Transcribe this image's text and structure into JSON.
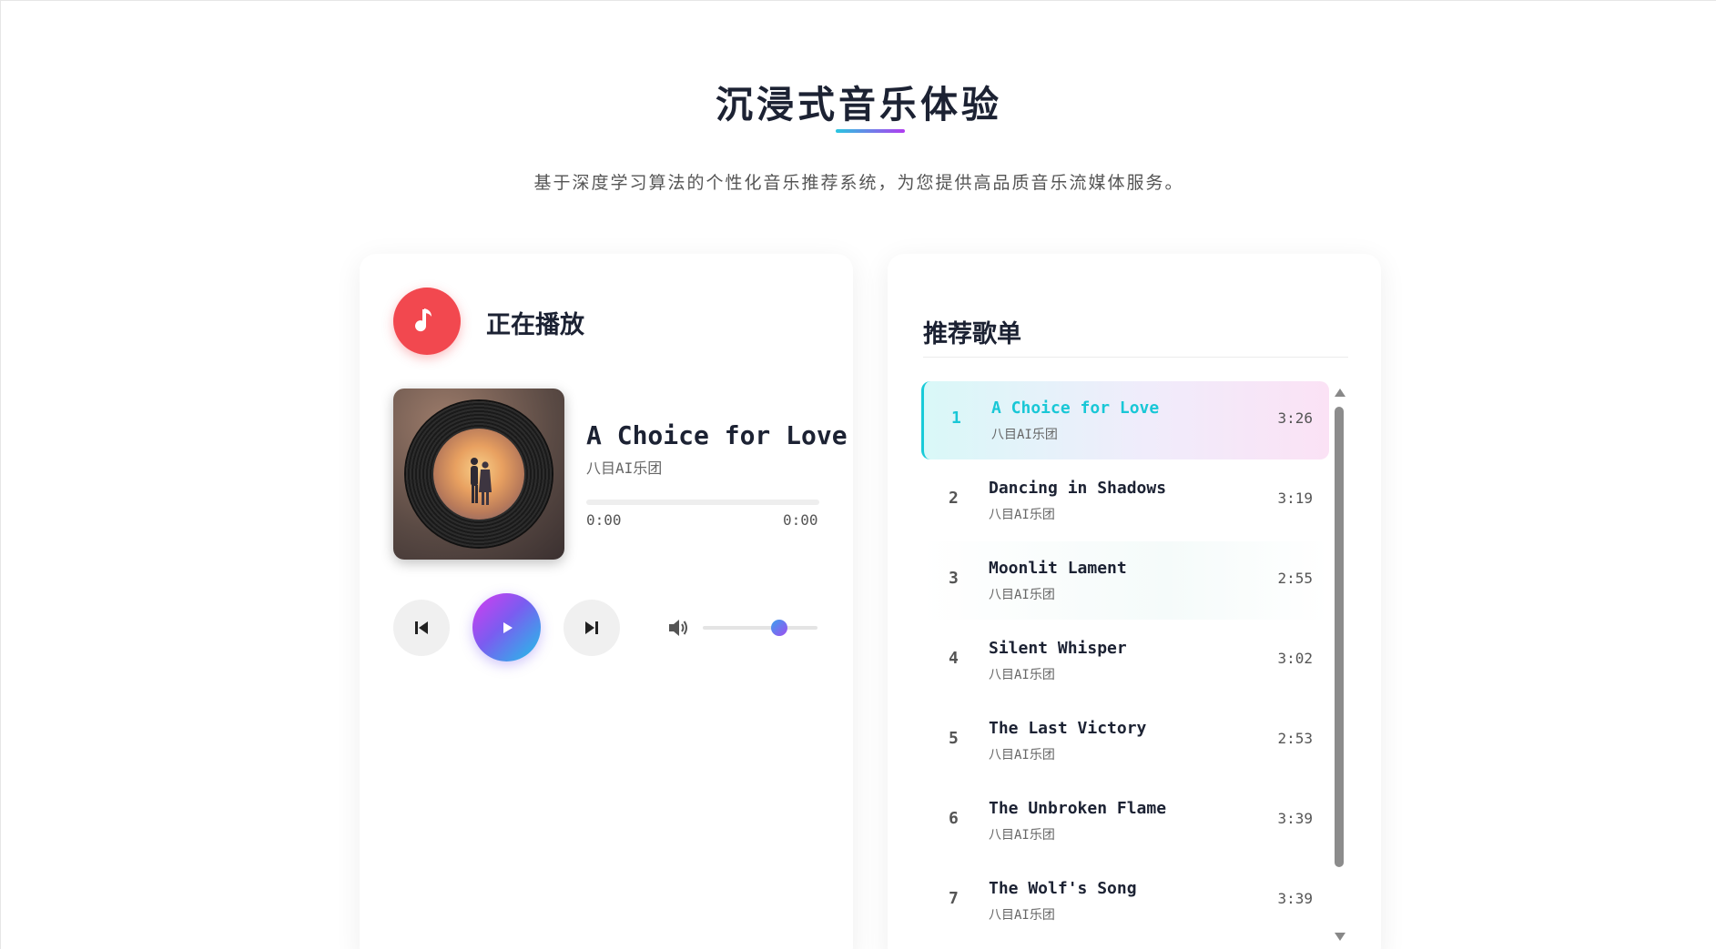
{
  "header": {
    "title": "沉浸式音乐体验",
    "subtitle": "基于深度学习算法的个性化音乐推荐系统，为您提供高品质音乐流媒体服务。"
  },
  "now_playing": {
    "heading": "正在播放",
    "song_title": "A Choice for Love",
    "artist": "八目AI乐团",
    "current_time": "0:00",
    "total_time": "0:00",
    "progress": 0,
    "volume": 0.67
  },
  "playlist": {
    "heading": "推荐歌单",
    "active_index": 0,
    "tracks": [
      {
        "num": "1",
        "title": "A Choice for Love",
        "artist": "八目AI乐团",
        "duration": "3:26"
      },
      {
        "num": "2",
        "title": "Dancing in Shadows",
        "artist": "八目AI乐团",
        "duration": "3:19"
      },
      {
        "num": "3",
        "title": "Moonlit Lament",
        "artist": "八目AI乐团",
        "duration": "2:55"
      },
      {
        "num": "4",
        "title": "Silent Whisper",
        "artist": "八目AI乐团",
        "duration": "3:02"
      },
      {
        "num": "5",
        "title": "The Last Victory",
        "artist": "八目AI乐团",
        "duration": "2:53"
      },
      {
        "num": "6",
        "title": "The Unbroken Flame",
        "artist": "八目AI乐团",
        "duration": "3:39"
      },
      {
        "num": "7",
        "title": "The Wolf's Song",
        "artist": "八目AI乐团",
        "duration": "3:39"
      }
    ]
  },
  "colors": {
    "accent_red": "#f2484f",
    "accent_cyan": "#19c7d6",
    "accent_purple": "#a04ef0"
  },
  "icons": {
    "now_playing": "music-note-icon",
    "prev": "skip-previous-icon",
    "play": "play-icon",
    "next": "skip-next-icon",
    "volume": "volume-icon"
  }
}
